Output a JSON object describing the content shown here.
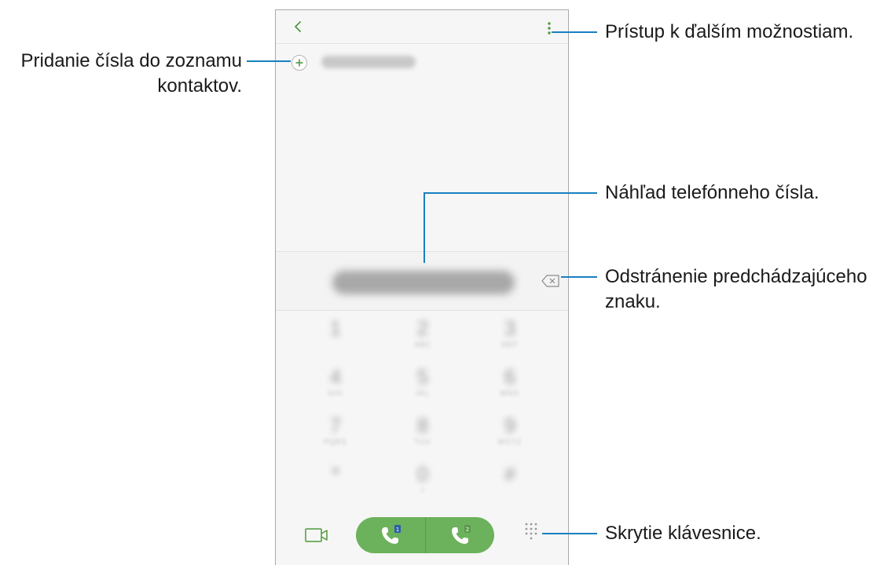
{
  "annotations": {
    "more_options": "Prístup k ďalším možnostiam.",
    "add_contact_line1": "Pridanie čísla do zoznamu",
    "add_contact_line2": "kontaktov.",
    "number_preview": "Náhľad telefónneho čísla.",
    "delete_char_line1": "Odstránenie predchádzajúceho",
    "delete_char_line2": "znaku.",
    "hide_keypad": "Skrytie klávesnice."
  },
  "phone": {
    "keypad": [
      {
        "digit": "1",
        "letters": ""
      },
      {
        "digit": "2",
        "letters": "ABC"
      },
      {
        "digit": "3",
        "letters": "DEF"
      },
      {
        "digit": "4",
        "letters": "GHI"
      },
      {
        "digit": "5",
        "letters": "JKL"
      },
      {
        "digit": "6",
        "letters": "MNO"
      },
      {
        "digit": "7",
        "letters": "PQRS"
      },
      {
        "digit": "8",
        "letters": "TUV"
      },
      {
        "digit": "9",
        "letters": "WXYZ"
      },
      {
        "digit": "*",
        "letters": ""
      },
      {
        "digit": "0",
        "letters": "+"
      },
      {
        "digit": "#",
        "letters": ""
      }
    ],
    "sim_badges": [
      "1",
      "2"
    ]
  },
  "colors": {
    "accent_green": "#6cb25c",
    "icon_green": "#4f9a3d",
    "callout_line": "#1a7fc1"
  },
  "icons": {
    "back": "chevron-left-icon",
    "more": "vertical-dots-icon",
    "add": "plus-circle-icon",
    "backspace": "backspace-icon",
    "video": "video-camera-icon",
    "call": "phone-handset-icon",
    "keypad": "dialpad-grid-icon"
  }
}
